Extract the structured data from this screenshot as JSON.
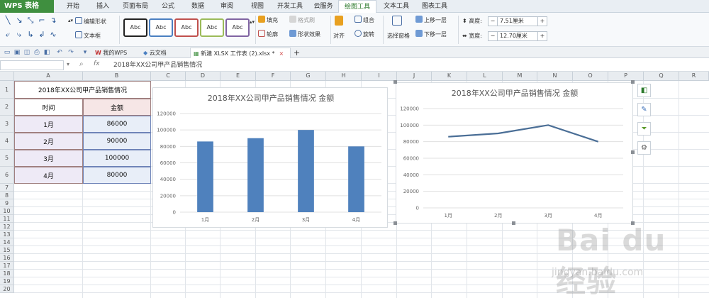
{
  "app": {
    "name": "WPS 表格"
  },
  "menu": {
    "tabs": [
      "开始",
      "插入",
      "页面布局",
      "公式",
      "数据",
      "审阅",
      "视图",
      "开发工具",
      "云服务",
      "绘图工具",
      "文本工具",
      "图表工具"
    ],
    "active": "绘图工具"
  },
  "ribbon": {
    "edit_shape": "编辑形状",
    "text_box": "文本框",
    "style_samples": [
      "Abc",
      "Abc",
      "Abc",
      "Abc",
      "Abc"
    ],
    "style_colors": [
      "#222222",
      "#4a7fc1",
      "#c0504d",
      "#9bbb59",
      "#8064a2"
    ],
    "fill": "填充",
    "format_painter": "格式刷",
    "outline": "轮廓",
    "shape_effect": "形状效果",
    "align": "对齐",
    "group": "组合",
    "rotate": "旋转",
    "selection_pane": "选择窗格",
    "bring_forward": "上移一层",
    "send_backward": "下移一层",
    "height_label": "高度:",
    "height_value": "7.51厘米",
    "width_label": "宽度:",
    "width_value": "12.70厘米"
  },
  "docbar": {
    "tabs": [
      {
        "label": "我的WPS"
      },
      {
        "label": "云文档"
      },
      {
        "label": "新建 XLSX 工作表 (2).xlsx *"
      }
    ],
    "close": "×",
    "add": "+"
  },
  "formula": {
    "fx": "fx",
    "content": "2018年XX公司甲产品销售情况"
  },
  "sheet": {
    "columns": [
      "A",
      "B",
      "C",
      "D",
      "E",
      "F",
      "G",
      "H",
      "I",
      "J",
      "K",
      "L",
      "M",
      "N",
      "O",
      "P",
      "Q",
      "R"
    ],
    "rows": [
      "1",
      "2",
      "3",
      "4",
      "5",
      "6",
      "7",
      "8",
      "9",
      "10",
      "11",
      "12",
      "13",
      "14",
      "15",
      "16",
      "17",
      "18",
      "19",
      "20"
    ],
    "table": {
      "title": "2018年XX公司甲产品销售情况",
      "headers": [
        "时间",
        "金额"
      ],
      "rows": [
        [
          "1月",
          "86000"
        ],
        [
          "2月",
          "90000"
        ],
        [
          "3月",
          "100000"
        ],
        [
          "4月",
          "80000"
        ]
      ]
    }
  },
  "chart_data": [
    {
      "type": "bar",
      "title": "2018年XX公司甲产品销售情况 金额",
      "categories": [
        "1月",
        "2月",
        "3月",
        "4月"
      ],
      "values": [
        86000,
        90000,
        100000,
        80000
      ],
      "ylim": [
        0,
        120000
      ],
      "yticks": [
        "0",
        "20000",
        "40000",
        "60000",
        "80000",
        "100000",
        "120000"
      ],
      "grid": true,
      "color": "#4f81bd"
    },
    {
      "type": "line",
      "title": "2018年XX公司甲产品销售情况 金额",
      "categories": [
        "1月",
        "2月",
        "3月",
        "4月"
      ],
      "values": [
        86000,
        90000,
        100000,
        80000
      ],
      "ylim": [
        0,
        120000
      ],
      "yticks": [
        "0",
        "20000",
        "40000",
        "60000",
        "80000",
        "100000",
        "120000"
      ],
      "grid": true,
      "color": "#4a6e96"
    }
  ],
  "side_tools": [
    "chart-elements-icon",
    "chart-style-icon",
    "chart-filter-icon",
    "settings-gear-icon"
  ],
  "watermark": {
    "text": "Bai du 经验",
    "url": "jingyan.baidu.com"
  }
}
